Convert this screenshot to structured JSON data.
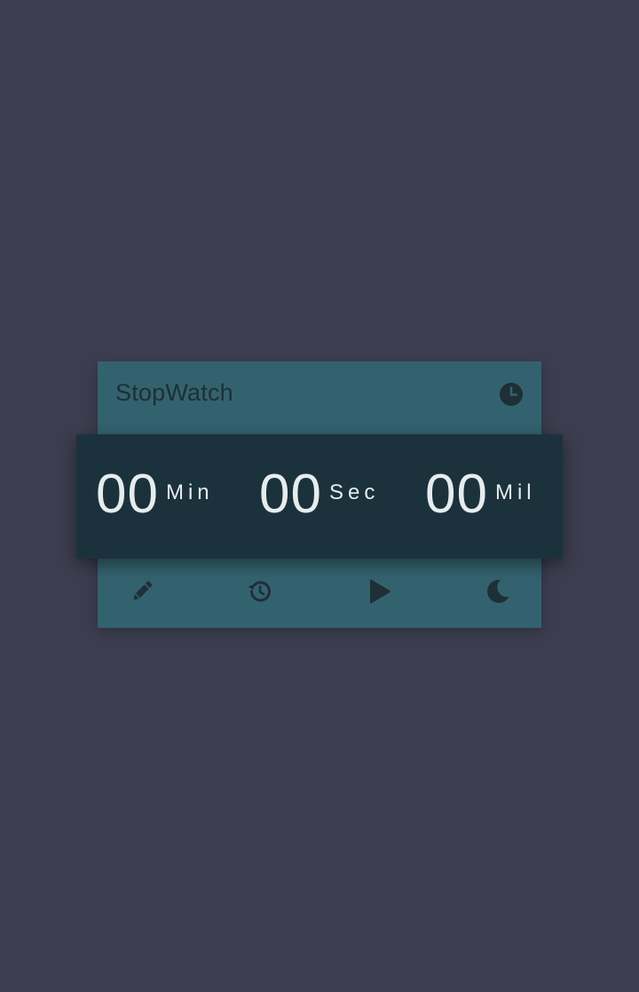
{
  "app": {
    "title": "StopWatch",
    "header_icon": "clock-icon"
  },
  "display": {
    "minutes": {
      "value": "00",
      "unit": "Min"
    },
    "seconds": {
      "value": "00",
      "unit": "Sec"
    },
    "millis": {
      "value": "00",
      "unit": "Mil"
    }
  },
  "toolbar": {
    "items": [
      {
        "icon": "pencil-icon"
      },
      {
        "icon": "history-icon"
      },
      {
        "icon": "play-icon"
      },
      {
        "icon": "moon-icon"
      }
    ]
  },
  "colors": {
    "background": "#3c3e50",
    "card": "#33626f",
    "display": "#1b323d",
    "icon": "#1e2f36",
    "digits": "#e6ecee"
  }
}
